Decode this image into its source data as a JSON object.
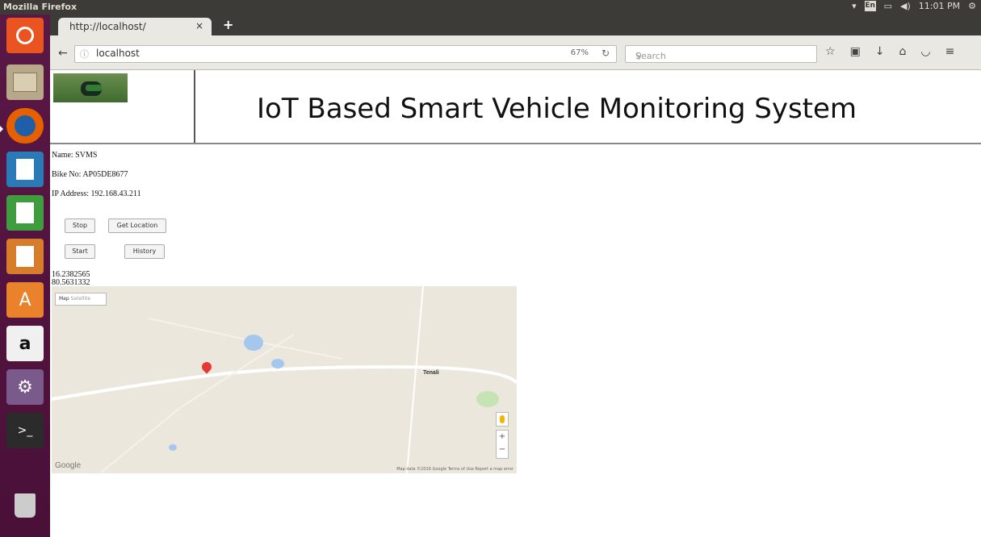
{
  "system": {
    "window_title": "Mozilla Firefox",
    "time": "11:01 PM",
    "keyboard": "En"
  },
  "launcher": {
    "items": [
      {
        "name": "dash-icon"
      },
      {
        "name": "files-icon"
      },
      {
        "name": "firefox-icon"
      },
      {
        "name": "writer-icon"
      },
      {
        "name": "calc-icon"
      },
      {
        "name": "impress-icon"
      },
      {
        "name": "software-center-icon"
      },
      {
        "name": "amazon-icon"
      },
      {
        "name": "settings-icon"
      },
      {
        "name": "terminal-icon"
      },
      {
        "name": "trash-icon"
      }
    ],
    "amazon_label": "a"
  },
  "browser": {
    "tab_title": "http://localhost/",
    "url": "localhost",
    "zoom": "67%",
    "search_placeholder": "Search"
  },
  "page": {
    "title": "IoT Based Smart Vehicle Monitoring System",
    "name_line": "Name: SVMS",
    "bike_line": "Bike No: AP05DE8677",
    "ip_line": "IP Address: 192.168.43.211",
    "buttons": {
      "stop": "Stop",
      "get_location": "Get Location",
      "start": "Start",
      "history": "History"
    },
    "latitude": "16.2382565",
    "longitude": "80.5631332",
    "map": {
      "map_type": "Map",
      "satellite": "Satellite",
      "google": "Google",
      "attribution": "Map data ©2016 Google   Terms of Use   Report a map error",
      "town": "Tenali",
      "zoom_in": "+",
      "zoom_out": "−"
    }
  }
}
